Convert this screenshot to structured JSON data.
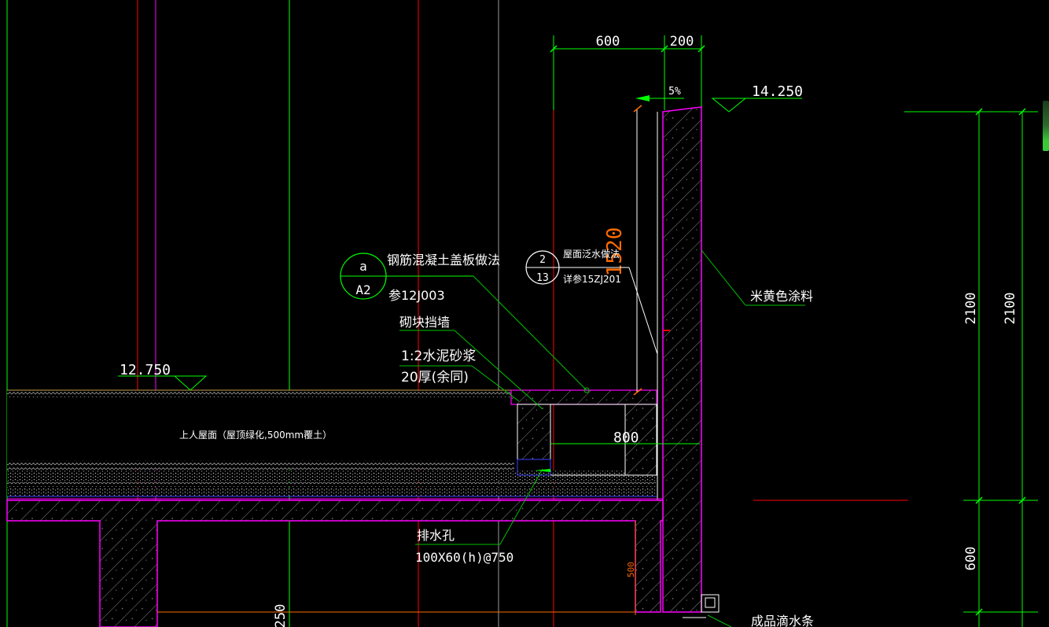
{
  "colors": {
    "background": "#000000",
    "dimension": "#00ff00",
    "axis_red": "#ff0000",
    "wall_outline": "#ff00ff",
    "hatch": "#9c9c9c",
    "text": "#ffffff",
    "orange": "#ff6a00",
    "leader": "#00c000",
    "slab_top": "#c8a050"
  },
  "dims": {
    "top_600": "600",
    "top_200": "200",
    "slope": "5%",
    "vertical_1520": "1520",
    "right_2100_a": "2100",
    "right_2100_b": "2100",
    "right_600": "600",
    "inner_800": "800",
    "inner_500": "500",
    "bottom_250": "250"
  },
  "elevations": {
    "top": "14.250",
    "roof": "12.750"
  },
  "callouts": {
    "a": {
      "top": "a",
      "bottom": "A2"
    },
    "b": {
      "top": "2",
      "bottom": "13"
    }
  },
  "labels": {
    "concrete_cover": "钢筋混凝土盖板做法",
    "concrete_ref": "参12J003",
    "block_wall": "砌块挡墙",
    "mortar": "1:2水泥砂浆",
    "mortar_thick": "20厚(余同)",
    "flashing": "屋面泛水做法",
    "flashing_ref": "详参15ZJ201",
    "coating": "米黄色涂料",
    "roof_use": "上人屋面（屋顶绿化,500mm覆土）",
    "drain": "排水孔",
    "drain_spec": "100X60(h)@750",
    "drip": "成品滴水条"
  }
}
